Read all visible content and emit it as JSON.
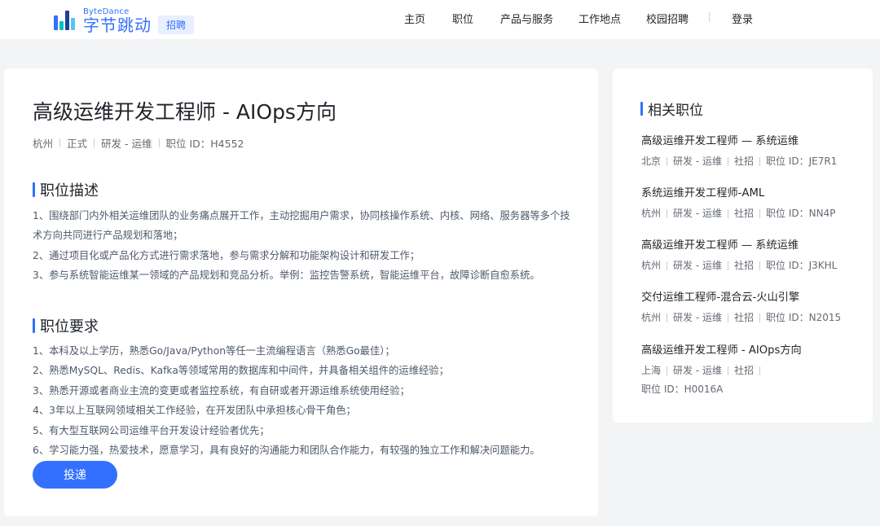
{
  "header": {
    "logo_en": "ByteDance",
    "logo_cn": "字节跳动",
    "badge": "招聘",
    "nav": [
      "主页",
      "职位",
      "产品与服务",
      "工作地点",
      "校园招聘"
    ],
    "login": "登录"
  },
  "job": {
    "title": "高级运维开发工程师 - AIOps方向",
    "meta": [
      "杭州",
      "正式",
      "研发 - 运维",
      "职位 ID：H4552"
    ],
    "description_title": "职位描述",
    "description": [
      "1、围绕部门内外相关运维团队的业务痛点展开工作，主动挖掘用户需求，协同核操作系统、内核、网络、服务器等多个技术方向共同进行产品规划和落地；",
      "2、通过项目化或产品化方式进行需求落地，参与需求分解和功能架构设计和研发工作；",
      "3、参与系统智能运维某一领域的产品规划和竞品分析。举例：监控告警系统，智能运维平台，故障诊断自愈系统。"
    ],
    "requirements_title": "职位要求",
    "requirements": [
      "1、本科及以上学历，熟悉Go/Java/Python等任一主流编程语言（熟悉Go最佳）；",
      "2、熟悉MySQL、Redis、Kafka等领域常用的数据库和中间件，并具备相关组件的运维经验；",
      "3、熟悉开源或者商业主流的变更或者监控系统，有自研或者开源运维系统使用经验；",
      "4、3年以上互联网领域相关工作经验，在开发团队中承担核心骨干角色；",
      "5、有大型互联网公司运维平台开发设计经验者优先；",
      "6、学习能力强，热爱技术，愿意学习，具有良好的沟通能力和团队合作能力，有较强的独立工作和解决问题能力。"
    ],
    "apply_label": "投递"
  },
  "related": {
    "title": "相关职位",
    "items": [
      {
        "title": "高级运维开发工程师 — 系统运维",
        "meta": [
          "北京",
          "研发 - 运维",
          "社招",
          "职位 ID：JE7R1"
        ]
      },
      {
        "title": "系统运维开发工程师-AML",
        "meta": [
          "杭州",
          "研发 - 运维",
          "社招",
          "职位 ID：NN4P"
        ]
      },
      {
        "title": "高级运维开发工程师 — 系统运维",
        "meta": [
          "杭州",
          "研发 - 运维",
          "社招",
          "职位 ID：J3KHL"
        ]
      },
      {
        "title": "交付运维工程师-混合云-火山引擎",
        "meta": [
          "杭州",
          "研发 - 运维",
          "社招",
          "职位 ID：N2015"
        ]
      },
      {
        "title": "高级运维开发工程师 - AIOps方向",
        "meta": [
          "上海",
          "研发 - 运维",
          "社招",
          "职位 ID：H0016A"
        ]
      }
    ]
  },
  "colors": {
    "accent": "#3370ff",
    "logo_bar_1": "#3370ff",
    "logo_bar_2": "#00c2c2",
    "logo_bar_3": "#1d3f99",
    "logo_bar_4": "#56c4f5"
  },
  "icons": {
    "logo": "bytedance-logo-icon"
  }
}
